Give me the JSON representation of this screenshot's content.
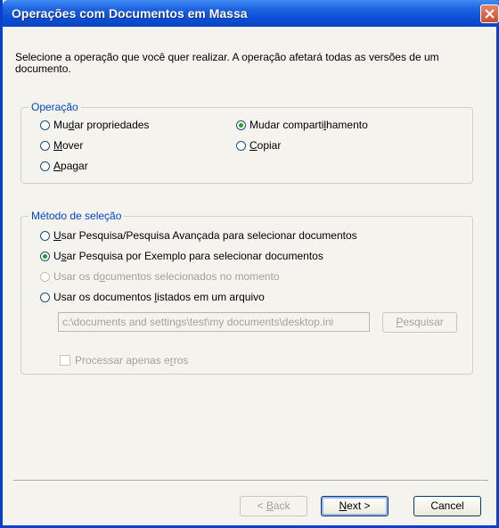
{
  "window": {
    "title": "Operações com Documentos em Massa"
  },
  "intro_text": "Selecione a operação que você quer realizar. A operação afetará todas as versões de um documento.",
  "operation_group": {
    "title": "Operação",
    "options": [
      {
        "label": "Mudar propriedades",
        "checked": false
      },
      {
        "label": "Mover",
        "checked": false
      },
      {
        "label": "Apagar",
        "checked": false
      },
      {
        "label": "Mudar compartilhamento",
        "checked": true
      },
      {
        "label": "Copiar",
        "checked": false
      }
    ]
  },
  "selection_group": {
    "title": "Método de seleção",
    "options": [
      {
        "label": "Usar Pesquisa/Pesquisa Avançada para selecionar documentos",
        "checked": false,
        "enabled": true
      },
      {
        "label": "Usar Pesquisa por Exemplo para selecionar documentos",
        "checked": true,
        "enabled": true
      },
      {
        "label": "Usar os documentos selecionados no momento",
        "checked": false,
        "enabled": false
      },
      {
        "label": "Usar os documentos listados em um arquivo",
        "checked": false,
        "enabled": true
      }
    ],
    "file_path_value": "c:\\documents and settings\\test\\my documents\\desktop.ini",
    "search_button": "Pesquisar",
    "errors_only_checkbox": {
      "label": "Processar apenas erros",
      "checked": false
    }
  },
  "footer": {
    "back": "< Back",
    "next": "Next >",
    "cancel": "Cancel"
  }
}
